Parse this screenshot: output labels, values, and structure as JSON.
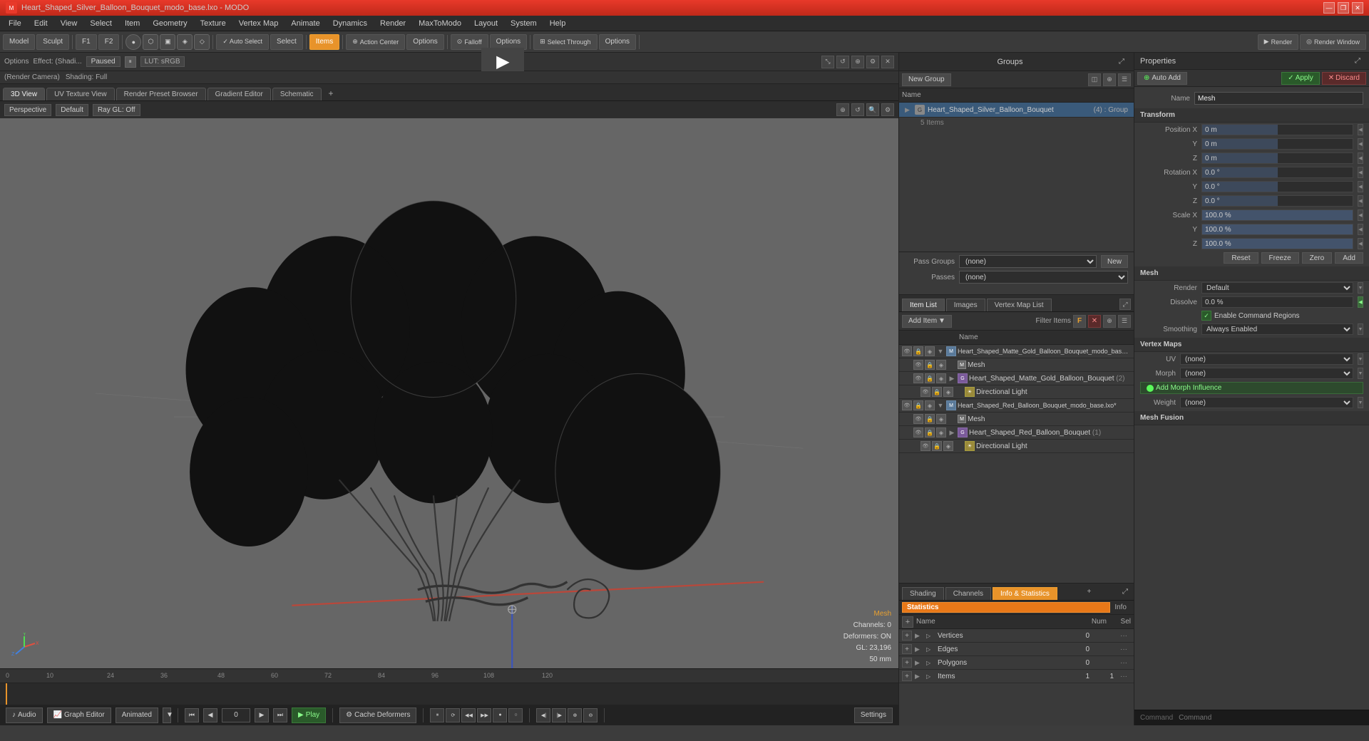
{
  "titlebar": {
    "title": "Heart_Shaped_Silver_Balloon_Bouquet_modo_base.lxo - MODO",
    "controls": [
      "—",
      "❐",
      "✕"
    ]
  },
  "menubar": {
    "items": [
      "File",
      "Edit",
      "View",
      "Select",
      "Item",
      "Geometry",
      "Texture",
      "Vertex Map",
      "Animate",
      "Dynamics",
      "Render",
      "MaxToModo",
      "Layout",
      "System",
      "Help"
    ]
  },
  "toolbar": {
    "mode_buttons": [
      "Model",
      "Sculpt"
    ],
    "f1": "F1",
    "f2": "F2",
    "select_label": "Select",
    "items_label": "Items",
    "action_center_label": "Action Center",
    "options1": "Options",
    "falloff_label": "Falloff",
    "options2": "Options",
    "select_through_label": "Select Through",
    "options3": "Options",
    "render_label": "Render",
    "render_window_label": "Render Window"
  },
  "preview": {
    "options_label": "Options",
    "effect_label": "Effect: (Shadi...",
    "paused_label": "Paused",
    "lut_label": "LUT: sRGB",
    "camera_label": "(Render Camera)",
    "shading_label": "Shading: Full"
  },
  "viewport_tabs": [
    "3D View",
    "UV Texture View",
    "Render Preset Browser",
    "Gradient Editor",
    "Schematic"
  ],
  "viewport_3d": {
    "perspective_label": "Perspective",
    "default_label": "Default",
    "ray_gl_label": "Ray GL: Off",
    "bottom_info": {
      "label": "Mesh",
      "channels": "Channels: 0",
      "deformers": "Deformers: ON",
      "gl": "GL: 23,196",
      "size": "50 mm"
    }
  },
  "timeline": {
    "ruler_marks": [
      "10",
      "24",
      "36",
      "48",
      "60",
      "72",
      "84",
      "96",
      "108",
      "120"
    ],
    "ruler_positions": [
      50,
      140,
      220,
      305,
      385,
      465,
      545,
      625,
      705,
      790
    ],
    "start": "0",
    "end": "120"
  },
  "bottom_bar": {
    "audio_label": "Audio",
    "graph_editor_label": "Graph Editor",
    "animated_label": "Animated",
    "frame_value": "0",
    "play_label": "Play",
    "cache_deformers_label": "Cache Deformers",
    "settings_label": "Settings",
    "command_label": "Command"
  },
  "groups": {
    "title": "Groups",
    "new_group_label": "New Group",
    "col_name": "Name",
    "group": {
      "name": "Heart_Shaped_Silver_Balloon_Bouquet",
      "count_label": "(4) : Group",
      "sub_label": "5 Items"
    }
  },
  "pass_groups": {
    "pass_groups_label": "Pass Groups",
    "passes_label": "Passes",
    "none_option": "(none)",
    "new_label": "New"
  },
  "properties": {
    "title": "Properties",
    "auto_add_label": "Auto Add",
    "apply_label": "Apply",
    "discard_label": "Discard",
    "name_label": "Name",
    "name_value": "Mesh",
    "transform_label": "Transform",
    "position_x_label": "Position X",
    "position_x_value": "0 m",
    "position_y_label": "Y",
    "position_y_value": "0 m",
    "position_z_label": "Z",
    "position_z_value": "0 m",
    "rotation_x_label": "Rotation X",
    "rotation_x_value": "0.0 °",
    "rotation_y_label": "Y",
    "rotation_y_value": "0.0 °",
    "rotation_z_label": "Z",
    "rotation_z_value": "0.0 °",
    "scale_x_label": "Scale X",
    "scale_x_value": "100.0 %",
    "scale_y_label": "Y",
    "scale_y_value": "100.0 %",
    "scale_z_label": "Z",
    "scale_z_value": "100.0 %",
    "reset_label": "Reset",
    "freeze_label": "Freeze",
    "zero_label": "Zero",
    "add_label": "Add",
    "mesh_section_label": "Mesh",
    "render_label": "Render",
    "render_value": "Default",
    "dissolve_label": "Dissolve",
    "dissolve_value": "0.0 %",
    "enable_command_regions_label": "Enable Command Regions",
    "smoothing_label": "Smoothing",
    "smoothing_value": "Always Enabled",
    "vertex_maps_label": "Vertex Maps",
    "uv_label": "UV",
    "uv_value": "(none)",
    "morph_label": "Morph",
    "morph_value": "(none)",
    "add_morph_influence_label": "Add Morph Influence",
    "weight_label": "Weight",
    "weight_value": "(none)",
    "mesh_fusion_label": "Mesh Fusion"
  },
  "item_list": {
    "tabs": [
      "Item List",
      "Images",
      "Vertex Map List"
    ],
    "add_item_label": "Add Item",
    "filter_items_label": "Filter Items",
    "col_name": "Name",
    "items": [
      {
        "id": 1,
        "indent": 0,
        "name": "Heart_Shaped_Matte_Gold_Balloon_Bouquet_modo_base.l...",
        "expand": true,
        "type": "mesh_group"
      },
      {
        "id": 2,
        "indent": 1,
        "name": "Mesh",
        "expand": false,
        "type": "mesh"
      },
      {
        "id": 3,
        "indent": 1,
        "name": "Heart_Shaped_Matte_Gold_Balloon_Bouquet",
        "expand": true,
        "type": "group",
        "suffix": "(2)"
      },
      {
        "id": 4,
        "indent": 2,
        "name": "Directional Light",
        "expand": false,
        "type": "light"
      },
      {
        "id": 5,
        "indent": 0,
        "name": "Heart_Shaped_Red_Balloon_Bouquet_modo_base.lxo*",
        "expand": true,
        "type": "mesh_group"
      },
      {
        "id": 6,
        "indent": 1,
        "name": "Mesh",
        "expand": false,
        "type": "mesh"
      },
      {
        "id": 7,
        "indent": 1,
        "name": "Heart_Shaped_Red_Balloon_Bouquet",
        "expand": true,
        "type": "group",
        "suffix": "(1)"
      },
      {
        "id": 8,
        "indent": 2,
        "name": "Directional Light",
        "expand": false,
        "type": "light"
      }
    ]
  },
  "stats": {
    "tabs": [
      "Shading",
      "Channels",
      "Info & Statistics"
    ],
    "active_tab": "Info & Statistics",
    "section_stats": "Statistics",
    "section_info": "Info",
    "col_name": "Name",
    "col_num": "Num",
    "col_sel": "Sel",
    "rows": [
      {
        "name": "Vertices",
        "num": "0",
        "sel": ""
      },
      {
        "name": "Edges",
        "num": "0",
        "sel": ""
      },
      {
        "name": "Polygons",
        "num": "0",
        "sel": ""
      },
      {
        "name": "Items",
        "num": "1",
        "sel": "1"
      }
    ]
  }
}
